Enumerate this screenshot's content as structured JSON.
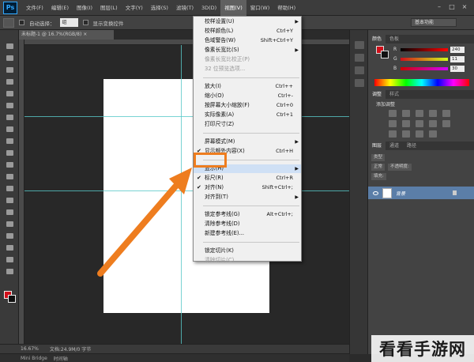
{
  "app": {
    "logo": "Ps"
  },
  "menubar": {
    "items": [
      "文件(F)",
      "编辑(E)",
      "图像(I)",
      "图层(L)",
      "文字(Y)",
      "选择(S)",
      "滤镜(T)",
      "3D(D)",
      "视图(V)",
      "窗口(W)",
      "帮助(H)"
    ],
    "active_index": 8
  },
  "window_controls": [
    "–",
    "□",
    "×"
  ],
  "options_bar": {
    "auto_select_label": "自动选择：",
    "auto_select_value": "组",
    "transform_label": "显示变换控件",
    "workspace": "基本功能"
  },
  "document_tab": "未标题-1 @ 16.7%(RGB/8) ×",
  "view_menu": {
    "items": [
      {
        "label": "校样设置(U)",
        "shortcut": "",
        "submenu": true,
        "disabled": false,
        "checked": false
      },
      {
        "label": "校样颜色(L)",
        "shortcut": "Ctrl+Y",
        "submenu": false,
        "disabled": false,
        "checked": false
      },
      {
        "label": "色域警告(W)",
        "shortcut": "Shift+Ctrl+Y",
        "submenu": false,
        "disabled": false,
        "checked": false
      },
      {
        "label": "像素长宽比(S)",
        "shortcut": "",
        "submenu": true,
        "disabled": false,
        "checked": false
      },
      {
        "label": "像素长宽比校正(P)",
        "shortcut": "",
        "submenu": false,
        "disabled": true,
        "checked": false
      },
      {
        "label": "32 位预览选项...",
        "shortcut": "",
        "submenu": false,
        "disabled": true,
        "checked": false
      },
      {
        "label": "放大(I)",
        "shortcut": "Ctrl++",
        "submenu": false,
        "disabled": false,
        "checked": false
      },
      {
        "label": "缩小(O)",
        "shortcut": "Ctrl+-",
        "submenu": false,
        "disabled": false,
        "checked": false
      },
      {
        "label": "按屏幕大小缩放(F)",
        "shortcut": "Ctrl+0",
        "submenu": false,
        "disabled": false,
        "checked": false
      },
      {
        "label": "实际像素(A)",
        "shortcut": "Ctrl+1",
        "submenu": false,
        "disabled": false,
        "checked": false
      },
      {
        "label": "打印尺寸(Z)",
        "shortcut": "",
        "submenu": false,
        "disabled": false,
        "checked": false
      },
      {
        "label": "屏幕模式(M)",
        "shortcut": "",
        "submenu": true,
        "disabled": false,
        "checked": false
      },
      {
        "label": "显示额外内容(X)",
        "shortcut": "Ctrl+H",
        "submenu": false,
        "disabled": false,
        "checked": true
      },
      {
        "label": "显示(H)",
        "shortcut": "",
        "submenu": true,
        "disabled": false,
        "checked": false
      },
      {
        "label": "标尺(R)",
        "shortcut": "Ctrl+R",
        "submenu": false,
        "disabled": false,
        "checked": true
      },
      {
        "label": "对齐(N)",
        "shortcut": "Shift+Ctrl+;",
        "submenu": false,
        "disabled": false,
        "checked": true
      },
      {
        "label": "对齐到(T)",
        "shortcut": "",
        "submenu": true,
        "disabled": false,
        "checked": false
      },
      {
        "label": "锁定参考线(G)",
        "shortcut": "Alt+Ctrl+;",
        "submenu": false,
        "disabled": false,
        "checked": false
      },
      {
        "label": "清除参考线(D)",
        "shortcut": "",
        "submenu": false,
        "disabled": false,
        "checked": false
      },
      {
        "label": "新建参考线(E)...",
        "shortcut": "",
        "submenu": false,
        "disabled": false,
        "checked": false
      },
      {
        "label": "锁定切片(K)",
        "shortcut": "",
        "submenu": false,
        "disabled": false,
        "checked": false
      },
      {
        "label": "清除切片(C)",
        "shortcut": "",
        "submenu": false,
        "disabled": true,
        "checked": false
      }
    ],
    "highlighted_label": "显示(H)"
  },
  "status_bar": {
    "zoom": "16.67%",
    "doc_info": "文档:24.9M/0 字节"
  },
  "mini_bridge": [
    "Mini Bridge",
    "时间轴"
  ],
  "panels": {
    "color_tabs": [
      "颜色",
      "色板"
    ],
    "color_values": {
      "R": "240",
      "G": "11",
      "B": "30"
    },
    "adjust_tabs": [
      "调整",
      "样式"
    ],
    "adjust_label": "添加调整",
    "layer_tabs": [
      "图层",
      "通道",
      "路径"
    ],
    "layer_filter": "类型",
    "blend_mode": "正常",
    "opacity_label": "不透明度:",
    "fill_label": "填充:",
    "layer_name": "背景"
  },
  "colors": {
    "accent_orange": "#ee7d1f",
    "guide_cyan": "#57c8c8",
    "foreground": "#d0101a"
  },
  "watermark": "看看手游网"
}
